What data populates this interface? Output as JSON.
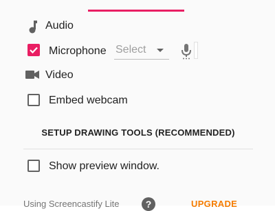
{
  "colors": {
    "accent": "#e91e63",
    "upgrade": "#f57c00",
    "text": "#212121",
    "muted": "#9e9e9e"
  },
  "audio": {
    "icon": "music-note-icon",
    "label": "Audio"
  },
  "microphone": {
    "checked": true,
    "label": "Microphone",
    "select_value": "Select",
    "icon": "mic-icon"
  },
  "video": {
    "icon": "videocam-icon",
    "label": "Video"
  },
  "embed_webcam": {
    "checked": false,
    "label": "Embed webcam"
  },
  "setup_button": {
    "label": "SETUP DRAWING TOOLS (RECOMMENDED)"
  },
  "preview_window": {
    "checked": false,
    "label": "Show preview window."
  },
  "footer": {
    "text": "Using Screencastify Lite",
    "help_icon": "?",
    "upgrade_label": "UPGRADE"
  }
}
